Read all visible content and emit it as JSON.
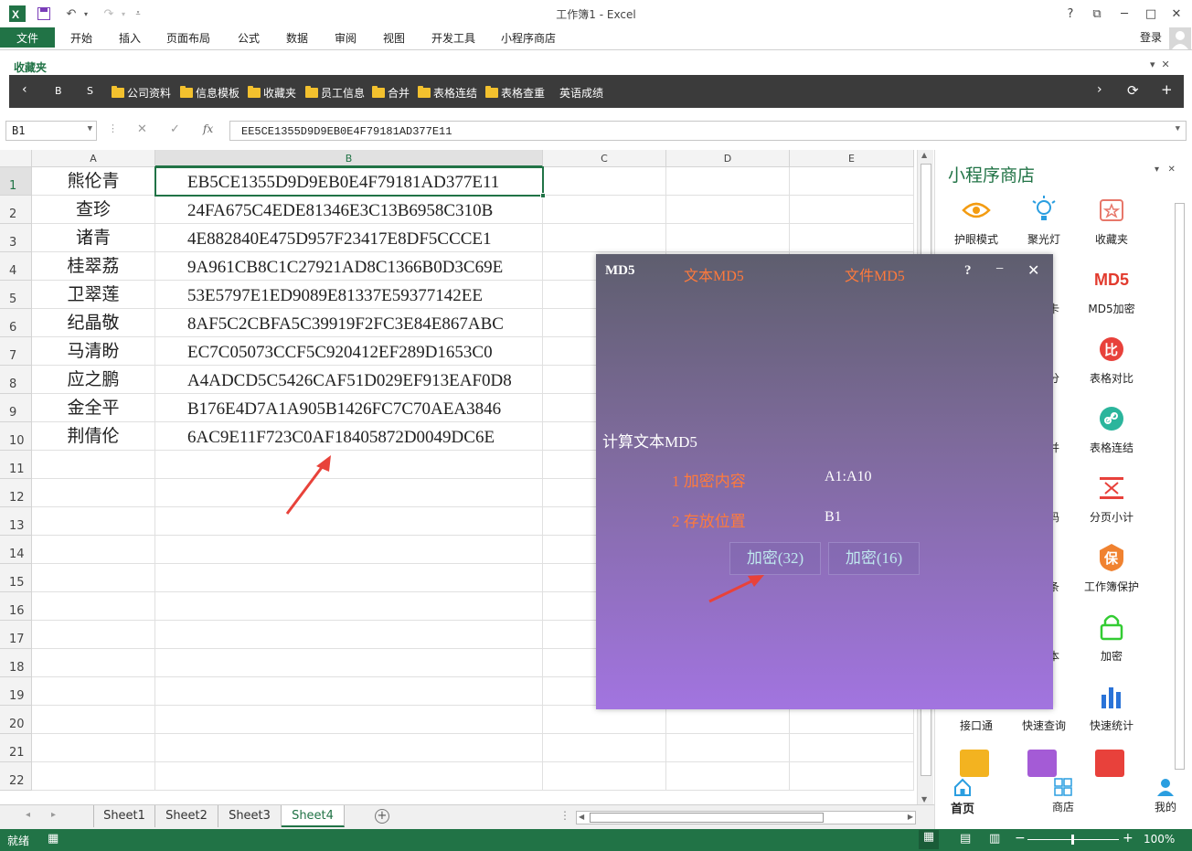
{
  "window": {
    "title": "工作簿1 - Excel",
    "help": "?"
  },
  "ribbon": {
    "file": "文件",
    "tabs": [
      "开始",
      "插入",
      "页面布局",
      "公式",
      "数据",
      "审阅",
      "视图",
      "开发工具",
      "小程序商店"
    ],
    "login": "登录"
  },
  "favorites": {
    "label": "收藏夹",
    "b_btn": "B",
    "s_btn": "S",
    "items": [
      "公司资料",
      "信息模板",
      "收藏夹",
      "员工信息",
      "合并",
      "表格连结",
      "表格查重"
    ],
    "last": "英语成绩",
    "plus": "+"
  },
  "formula_bar": {
    "name_box": "B1",
    "fx": "fx",
    "value": "EE5CE1355D9D9EB0E4F79181AD377E11"
  },
  "grid": {
    "columns": [
      "A",
      "B",
      "C",
      "D",
      "E"
    ],
    "rows": [
      "1",
      "2",
      "3",
      "4",
      "5",
      "6",
      "7",
      "8",
      "9",
      "10",
      "11",
      "12",
      "13",
      "14",
      "15",
      "16",
      "17",
      "18",
      "19",
      "20",
      "21",
      "22"
    ],
    "names": [
      "熊伦青",
      "查珍",
      "诸青",
      "桂翠荔",
      "卫翠莲",
      "纪晶敬",
      "马清盼",
      "应之鹏",
      "金全平",
      "荆倩伦"
    ],
    "hashes": [
      "EB5CE1355D9D9EB0E4F79181AD377E11",
      "24FA675C4EDE81346E3C13B6958C310B",
      "4E882840E475D957F23417E8DF5CCCE1",
      "9A961CB8C1C27921AD8C1366B0D3C69E",
      "53E5797E1ED9089E81337E59377142EE",
      "8AF5C2CBFA5C39919F2FC3E84E867ABC",
      "EC7C05073CCF5C920412EF289D1653C0",
      "A4ADCD5C5426CAF51D029EF913EAF0D8",
      "B176E4D7A1A905B1426FC7C70AEA3846",
      "6AC9E11F723C0AF18405872D0049DC6E"
    ]
  },
  "sheets": {
    "tabs": [
      "Sheet1",
      "Sheet2",
      "Sheet3",
      "Sheet4"
    ],
    "active": "Sheet4"
  },
  "status": {
    "ready": "就绪",
    "zoom": "100%"
  },
  "panel": {
    "title": "小程序商店",
    "apps": [
      {
        "label": "护眼模式",
        "icon": "eye-icon"
      },
      {
        "label": "聚光灯",
        "icon": "bulb-icon"
      },
      {
        "label": "收藏夹",
        "icon": "star-folder-icon"
      },
      {
        "label": "卡",
        "icon": "card-icon"
      },
      {
        "label": "MD5加密",
        "icon": "md5-icon"
      },
      {
        "label": "分",
        "icon": "split-icon"
      },
      {
        "label": "表格对比",
        "icon": "compare-icon"
      },
      {
        "label": "并",
        "icon": "merge-icon"
      },
      {
        "label": "表格连结",
        "icon": "link-icon"
      },
      {
        "label": "码",
        "icon": "code-icon"
      },
      {
        "label": "分页小计",
        "icon": "subtotal-icon"
      },
      {
        "label": "条",
        "icon": "bar-icon"
      },
      {
        "label": "工作簿保护",
        "icon": "protect-icon"
      },
      {
        "label": "本",
        "icon": "book-icon"
      },
      {
        "label": "加密",
        "icon": "lock-icon"
      },
      {
        "label": "接口通",
        "icon": "api-icon"
      },
      {
        "label": "快速查询",
        "icon": "search-icon"
      },
      {
        "label": "快速统计",
        "icon": "stats-icon"
      }
    ],
    "md5_logo": "MD5",
    "compare_glyph": "比",
    "protect_glyph": "保",
    "nav": [
      {
        "label": "首页",
        "icon": "home-icon"
      },
      {
        "label": "商店",
        "icon": "store-icon"
      },
      {
        "label": "我的",
        "icon": "user-icon"
      }
    ]
  },
  "dialog": {
    "title": "MD5",
    "tab_text": "文本MD5",
    "tab_file": "文件MD5",
    "help": "?",
    "section": "计算文本MD5",
    "content_label": "1 加密内容",
    "content_value": "A1:A10",
    "location_label": "2 存放位置",
    "location_value": "B1",
    "btn32": "加密(32)",
    "btn16": "加密(16)"
  },
  "colors": {
    "excel_green": "#217346",
    "dialog_orange": "#ff7a3c",
    "arrow_red": "#e8423a"
  }
}
